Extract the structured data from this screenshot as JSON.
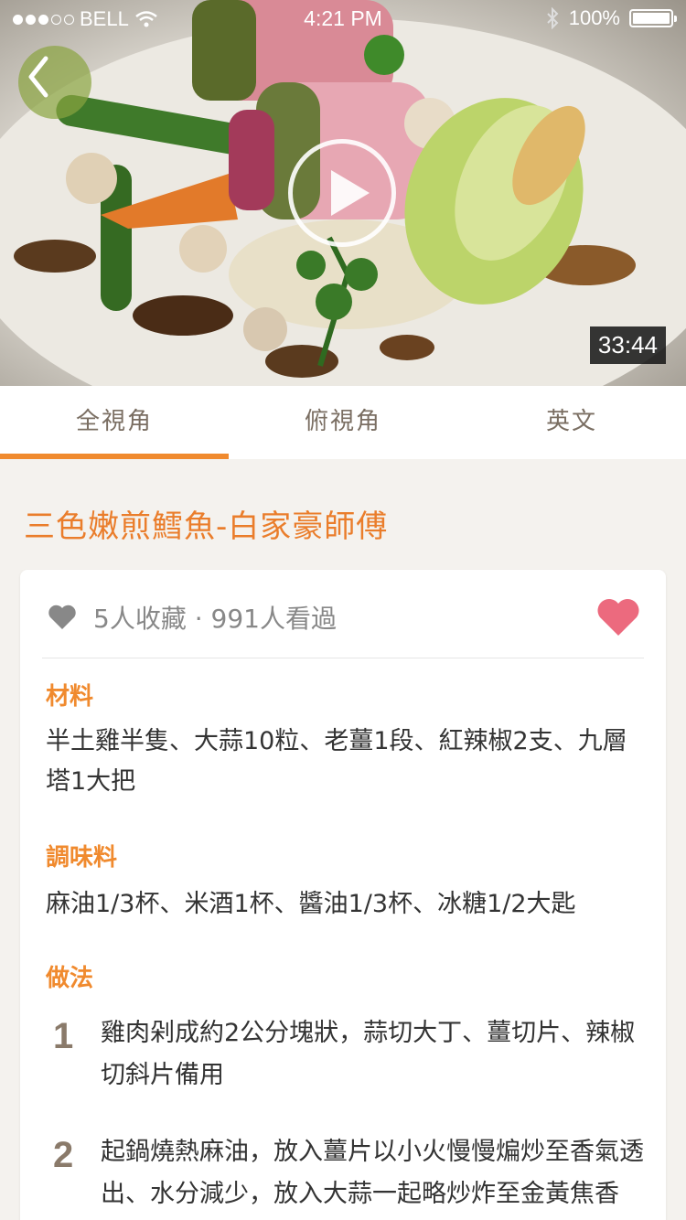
{
  "status_bar": {
    "carrier": "BELL",
    "time": "4:21 PM",
    "battery": "100%"
  },
  "video": {
    "duration": "33:44"
  },
  "tabs": [
    {
      "label": "全視角",
      "active": true
    },
    {
      "label": "俯視角",
      "active": false
    },
    {
      "label": "英文",
      "active": false
    }
  ],
  "recipe": {
    "title": "三色嫩煎鱈魚-白家豪師傅",
    "stats": "5人收藏 · 991人看過",
    "ingredients_title": "材料",
    "ingredients": "半土雞半隻、大蒜10粒、老薑1段、紅辣椒2支、九層塔1大把",
    "seasoning_title": "調味料",
    "seasoning": "麻油1/3杯、米酒1杯、醬油1/3杯、冰糖1/2大匙",
    "method_title": "做法",
    "steps": [
      {
        "num": "1",
        "text": "雞肉剁成約2公分塊狀，蒜切大丁、薑切片、辣椒切斜片備用"
      },
      {
        "num": "2",
        "text": "起鍋燒熱麻油，放入薑片以小火慢慢煸炒至香氣透出、水分減少，放入大蒜一起略炒炸至金黃焦香"
      }
    ]
  },
  "colors": {
    "accent": "#f08a2e",
    "title": "#ea7d2b",
    "heart": "#ec6a7e"
  }
}
